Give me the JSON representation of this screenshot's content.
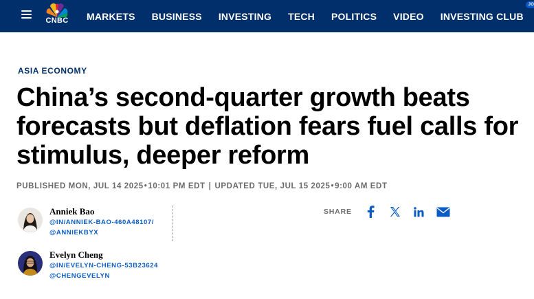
{
  "nav": {
    "logo_text": "CNBC",
    "items": [
      {
        "label": "MARKETS"
      },
      {
        "label": "BUSINESS"
      },
      {
        "label": "INVESTING"
      },
      {
        "label": "TECH"
      },
      {
        "label": "POLITICS"
      },
      {
        "label": "VIDEO"
      }
    ],
    "club_label": "INVESTING CLUB",
    "club_badge": "JOIN",
    "bg_color": "#002f6c"
  },
  "article": {
    "kicker": "ASIA ECONOMY",
    "headline": "China’s second-quarter growth beats forecasts but deflation fears fuel calls for stimulus, deeper reform",
    "published_label": "PUBLISHED MON, JUL 14 2025",
    "published_time": "10:01 PM EDT",
    "separator": "|",
    "updated_label": "UPDATED TUE, JUL 15 2025",
    "updated_time": "9:00 AM EDT",
    "dot": "•"
  },
  "authors": [
    {
      "name": "Anniek Bao",
      "link1": "@IN/ANNIEK-BAO-460A48107/",
      "link2": "@ANNIEKBYX",
      "avatar_icon": "person-avatar"
    },
    {
      "name": "Evelyn Cheng",
      "link1": "@IN/EVELYN-CHENG-53B23624",
      "link2": "@CHENGEVELYN",
      "avatar_icon": "person-avatar"
    }
  ],
  "share": {
    "label": "SHARE",
    "icons": [
      "facebook-icon",
      "x-icon",
      "linkedin-icon",
      "email-icon"
    ],
    "icon_color": "#0a5cc4"
  }
}
